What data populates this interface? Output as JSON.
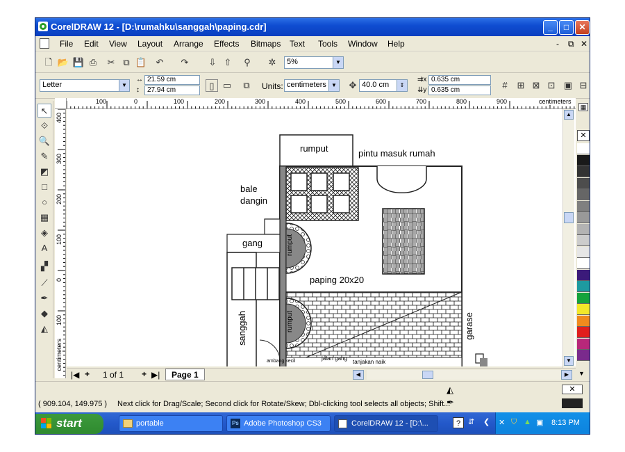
{
  "window": {
    "title": "CorelDRAW 12 - [D:\\rumahku\\sanggah\\paping.cdr]",
    "controls": {
      "minimize": "_",
      "restore": "□",
      "close": "✕"
    }
  },
  "menu": {
    "items": [
      "File",
      "Edit",
      "View",
      "Layout",
      "Arrange",
      "Effects",
      "Bitmaps",
      "Text",
      "Tools",
      "Window",
      "Help"
    ],
    "doc_controls": {
      "minimize": "-",
      "restore": "⧉",
      "close": "✕"
    }
  },
  "standard_toolbar": {
    "zoom_value": "5%"
  },
  "property_bar": {
    "paper_type": "Letter",
    "width": "21.59 cm",
    "height": "27.94 cm",
    "units_label": "Units:",
    "units_value": "centimeters",
    "nudge": "40.0 cm",
    "dup_x": "0.635 cm",
    "dup_y": "0.635 cm"
  },
  "rulers": {
    "h_labels": [
      "100",
      "0",
      "100",
      "200",
      "300",
      "400",
      "500",
      "600",
      "700",
      "800",
      "900"
    ],
    "h_unit": "centimeters",
    "v_labels": [
      "400",
      "300",
      "200",
      "100",
      "0",
      "100"
    ],
    "v_unit": "centimeters"
  },
  "drawing": {
    "rumput_top": "rumput",
    "pintu_masuk": "pintu masuk rumah",
    "bale_dangin_1": "bale",
    "bale_dangin_2": "dangin",
    "gang": "gang",
    "rumput_left_1": "rumput",
    "rumput_left_2": "rumput",
    "paping": "paping 20x20",
    "sanggah": "sanggah",
    "garase": "garase",
    "tanjakan": "tanjakan naik",
    "jalan_gang": "jalan gang",
    "small_label": "ambang kecil"
  },
  "page_nav": {
    "page_count": "1 of 1",
    "page_tab": "Page 1"
  },
  "status": {
    "coords": "( 909.104, 149.975 )",
    "hint": "Next click for Drag/Scale; Second click for Rotate/Skew; Dbl-clicking tool selects all objects; Shift..."
  },
  "taskbar": {
    "start": "start",
    "tasks": [
      "portable",
      "Adobe Photoshop CS3",
      "CorelDRAW 12 - [D:\\..."
    ],
    "clock": "8:13 PM"
  },
  "palette_colors": [
    "#ffffff",
    "#1a1a1a",
    "#333333",
    "#4d4d4d",
    "#666666",
    "#808080",
    "#999999",
    "#b3b3b3",
    "#cccccc",
    "#e6e6e6",
    "#ffffff",
    "#3b1a7a",
    "#1e9aa0",
    "#14a33c",
    "#f2e82a",
    "#f08a1e",
    "#e01e1e",
    "#b8287a",
    "#7a2a8c"
  ]
}
